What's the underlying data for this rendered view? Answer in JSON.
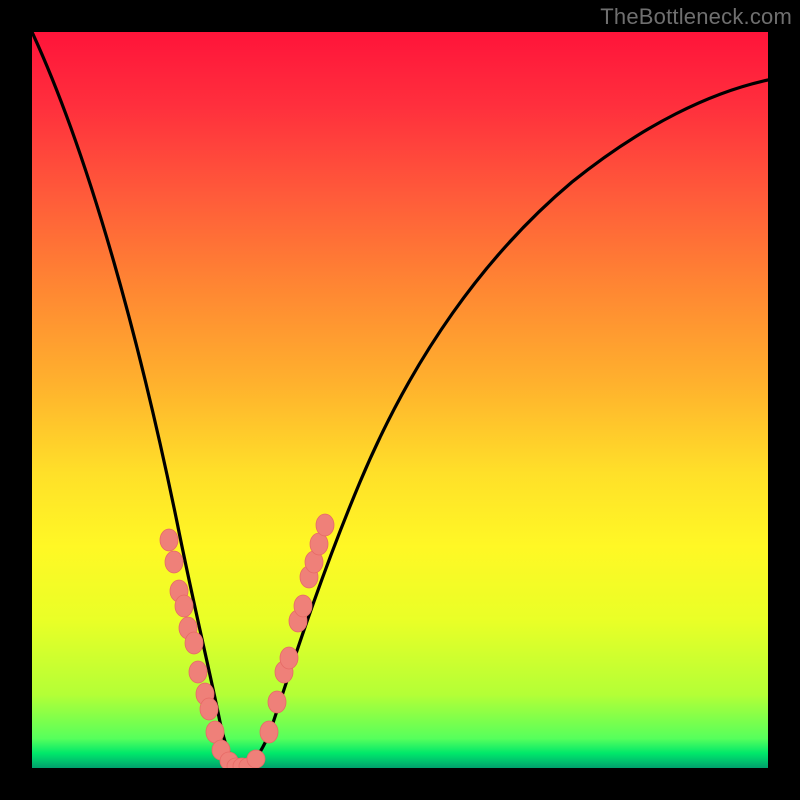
{
  "watermark": "TheBottleneck.com",
  "chart_data": {
    "type": "line",
    "title": "",
    "xlabel": "",
    "ylabel": "",
    "xlim": [
      0,
      100
    ],
    "ylim": [
      0,
      100
    ],
    "grid": false,
    "legend": false,
    "series": [
      {
        "name": "curve",
        "x": [
          0,
          5,
          10,
          15,
          18,
          21,
          23,
          25,
          26,
          27,
          28,
          30,
          32,
          34,
          36,
          40,
          44,
          48,
          52,
          58,
          64,
          70,
          78,
          86,
          94,
          100
        ],
        "y": [
          100,
          82,
          63,
          44,
          33,
          21,
          13,
          6,
          2,
          0,
          0,
          0,
          4,
          11,
          20,
          34,
          45,
          53,
          60,
          68,
          74,
          79,
          84,
          88,
          91,
          93
        ]
      }
    ],
    "markers": [
      {
        "x": 18.5,
        "y": 31
      },
      {
        "x": 19.3,
        "y": 28
      },
      {
        "x": 20.0,
        "y": 24
      },
      {
        "x": 20.6,
        "y": 22
      },
      {
        "x": 21.2,
        "y": 19
      },
      {
        "x": 21.9,
        "y": 17
      },
      {
        "x": 22.6,
        "y": 13
      },
      {
        "x": 23.5,
        "y": 10
      },
      {
        "x": 24.0,
        "y": 8
      },
      {
        "x": 24.9,
        "y": 5
      },
      {
        "x": 25.7,
        "y": 2.5
      },
      {
        "x": 26.8,
        "y": 1
      },
      {
        "x": 27.7,
        "y": 0
      },
      {
        "x": 28.5,
        "y": 0
      },
      {
        "x": 29.3,
        "y": 0
      },
      {
        "x": 30.5,
        "y": 1.2
      },
      {
        "x": 32.2,
        "y": 5
      },
      {
        "x": 33.3,
        "y": 9
      },
      {
        "x": 34.3,
        "y": 13
      },
      {
        "x": 34.9,
        "y": 15
      },
      {
        "x": 36.2,
        "y": 20
      },
      {
        "x": 36.8,
        "y": 22
      },
      {
        "x": 37.6,
        "y": 26
      },
      {
        "x": 38.3,
        "y": 28
      },
      {
        "x": 39.0,
        "y": 30.5
      },
      {
        "x": 39.8,
        "y": 33
      }
    ],
    "background_gradient": {
      "stops": [
        {
          "pos": 0.0,
          "color": "#ff143a"
        },
        {
          "pos": 0.1,
          "color": "#ff2f3d"
        },
        {
          "pos": 0.22,
          "color": "#ff5a3a"
        },
        {
          "pos": 0.34,
          "color": "#ff8433"
        },
        {
          "pos": 0.48,
          "color": "#ffb22d"
        },
        {
          "pos": 0.6,
          "color": "#ffe029"
        },
        {
          "pos": 0.7,
          "color": "#fff825"
        },
        {
          "pos": 0.8,
          "color": "#e9ff27"
        },
        {
          "pos": 0.9,
          "color": "#b4ff36"
        },
        {
          "pos": 0.96,
          "color": "#56ff5c"
        },
        {
          "pos": 0.98,
          "color": "#00e86a"
        },
        {
          "pos": 0.99,
          "color": "#00c56d"
        },
        {
          "pos": 1.0,
          "color": "#00a06c"
        }
      ]
    },
    "colors": {
      "curve": "#000000",
      "markers_fill": "#ef8079",
      "markers_stroke": "#e76a66",
      "frame": "#000000"
    }
  }
}
